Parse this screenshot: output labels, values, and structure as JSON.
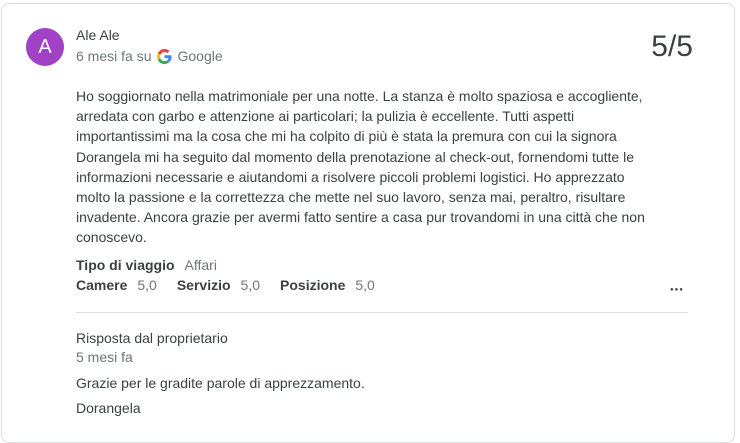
{
  "review": {
    "avatar_letter": "A",
    "avatar_color": "#a142c6",
    "author": "Ale Ale",
    "time": "6 mesi fa su",
    "source": "Google",
    "rating": "5/5",
    "text": "Ho soggiornato nella matrimoniale per una notte. La stanza è molto spaziosa e accogliente, arredata con garbo e attenzione ai particolari; la pulizia è eccellente. Tutti aspetti importantissimi ma la cosa che mi ha colpito di più è stata la premura con cui la signora Dorangela mi ha seguito dal momento della prenotazione al check-out, fornendomi tutte le informazioni necessarie e aiutandomi a risolvere piccoli problemi logistici. Ho apprezzato molto la passione e la correttezza che mette nel suo lavoro, senza mai, peraltro, risultare invadente. Ancora grazie per avermi fatto sentire a casa pur trovandomi in una città che non conoscevo.",
    "trip_type_label": "Tipo di viaggio",
    "trip_type_value": "Affari",
    "ratings": [
      {
        "label": "Camere",
        "value": "5,0"
      },
      {
        "label": "Servizio",
        "value": "5,0"
      },
      {
        "label": "Posizione",
        "value": "5,0"
      }
    ],
    "more_icon": "more-horiz-icon"
  },
  "owner_response": {
    "label": "Risposta dal proprietario",
    "time": "5 mesi fa",
    "text": "Grazie per le gradite parole di apprezzamento.",
    "signature": "Dorangela"
  }
}
